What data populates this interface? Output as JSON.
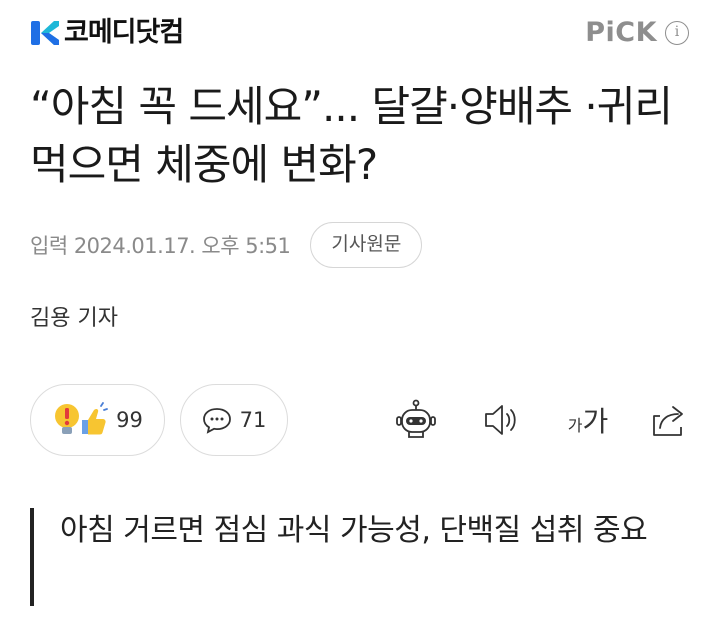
{
  "header": {
    "logo_text": "코메디닷컴",
    "pick_label": "PiCK",
    "info_icon": "i"
  },
  "article": {
    "title": "“아침 꼭 드세요”... 달걀·양배추 ·귀리 먹으면 체중에 변화?",
    "date": "입력 2024.01.17. 오후 5:51",
    "original_button": "기사원문",
    "byline": "김용 기자",
    "subtitle": "아침 거르면 점심 과식 가능성, 단백질 섭취 중요"
  },
  "actions": {
    "reaction_count": "99",
    "comment_count": "71",
    "font_small": "가",
    "font_big": "가"
  },
  "colors": {
    "brand_blue": "#1f6fe5",
    "brand_teal": "#1fb8d8",
    "reaction_yellow": "#f7c531"
  },
  "icons": {
    "logo": "comedy-logo-icon",
    "info": "info-icon",
    "reaction": "lightbulb-thumbs-icon",
    "comment": "speech-bubble-icon",
    "robot": "robot-icon",
    "speaker": "speaker-icon",
    "share": "share-icon"
  }
}
